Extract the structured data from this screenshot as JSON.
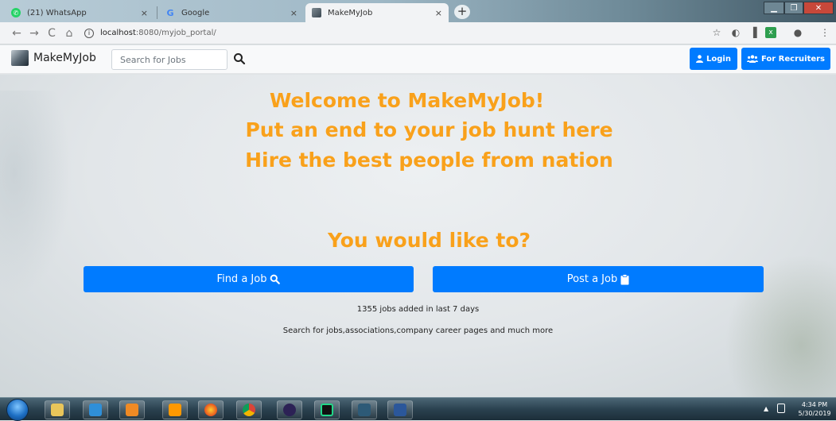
{
  "browser": {
    "tabs": [
      {
        "title": "(21) WhatsApp",
        "favicon": "whatsapp-icon"
      },
      {
        "title": "Google",
        "favicon": "google-icon"
      },
      {
        "title": "MakeMyJob",
        "favicon": "makemyjob-icon",
        "active": true
      }
    ],
    "close_glyph": "×",
    "new_tab_glyph": "+",
    "url": {
      "host": "localhost",
      "path": ":8080/myjob_portal/"
    }
  },
  "site": {
    "brand": "MakeMyJob",
    "search": {
      "placeholder": "Search for Jobs"
    },
    "login_label": "Login",
    "recruiters_label": "For Recruiters"
  },
  "hero": {
    "line1": "Welcome to MakeMyJob!",
    "line2": "Put an end to your job hunt here",
    "line3": "Hire the best people from nation",
    "question": "You would like to?",
    "find_job_label": "Find a Job",
    "post_job_label": "Post a Job",
    "jobs_stat": "1355 jobs added in last 7 days",
    "tagline": "Search for jobs,associations,company career pages and much more"
  },
  "taskbar": {
    "time": "4:34 PM",
    "date": "5/30/2019"
  },
  "colors": {
    "accent": "#007bff",
    "heading": "#f9a11b"
  }
}
